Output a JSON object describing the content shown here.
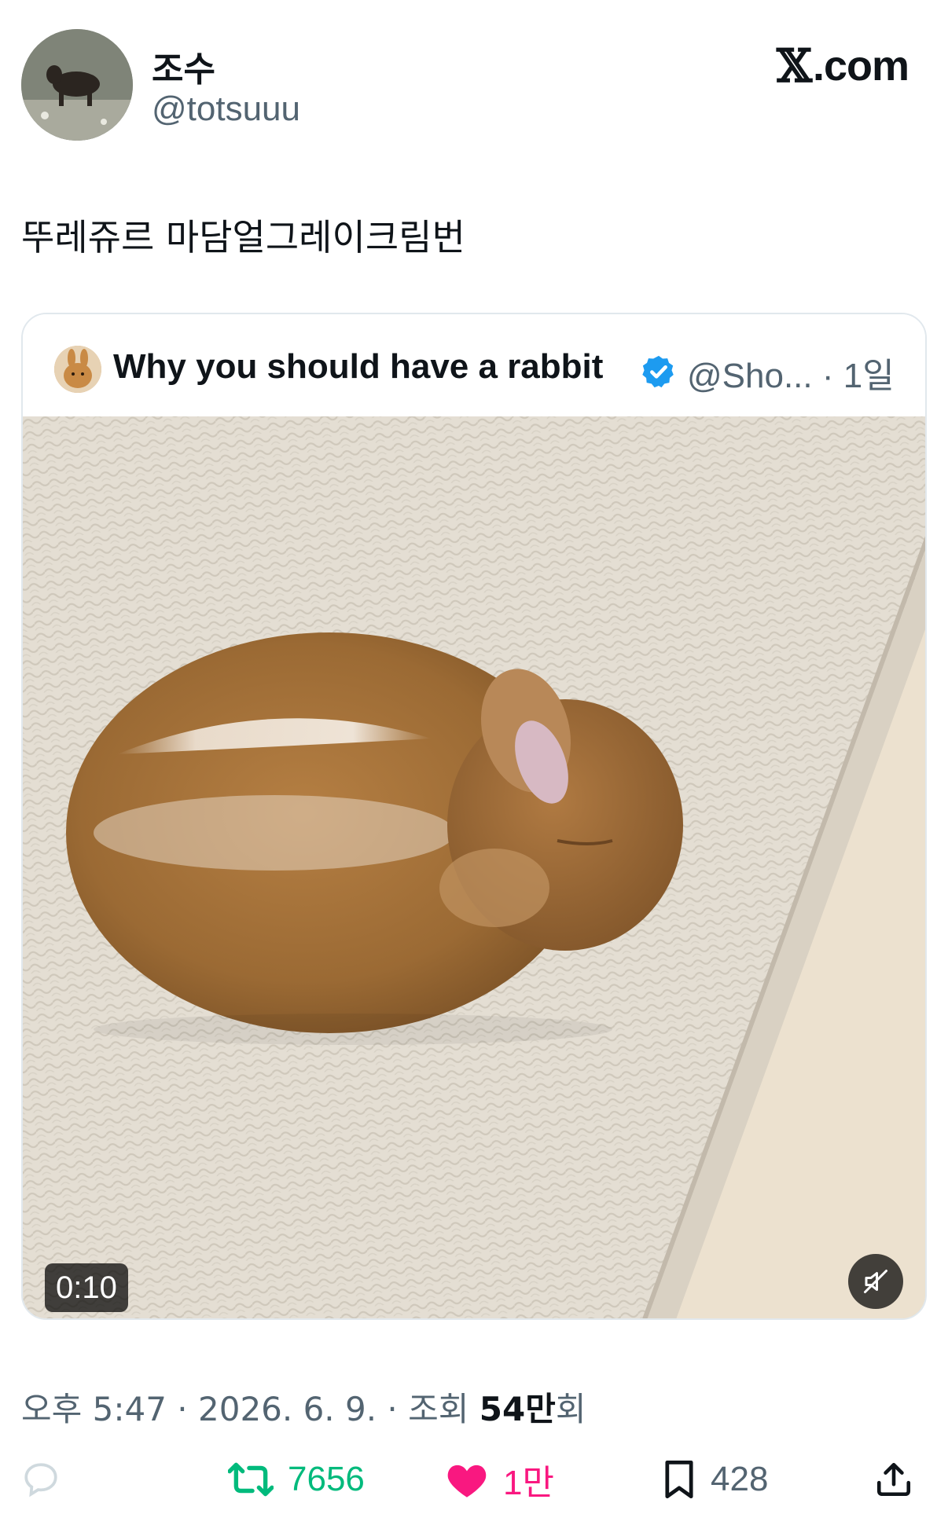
{
  "author": {
    "display_name": "조수",
    "handle": "@totsuuu"
  },
  "brand": {
    "x_glyph": "𝕏",
    "text": ".com"
  },
  "tweet": {
    "text": "뚜레쥬르 마담얼그레이크림번"
  },
  "quote": {
    "display_name": "Why you should have a rabbit",
    "handle_time": "@Sho... · 1일",
    "verified_color": "#1d9bf0",
    "media": {
      "duration": "0:10",
      "muted": true
    }
  },
  "meta": {
    "time_date": "오후 5:47 · 2026. 6. 9. · 조회 ",
    "views_number": "54만",
    "views_suffix": "회"
  },
  "actions": {
    "reply_icon": "reply-icon",
    "retweet_count": "7656",
    "retweet_color": "#00ba7c",
    "like_count": "1만",
    "like_color": "#f91880",
    "liked": true,
    "bookmark_count": "428",
    "share_icon": "share-icon"
  }
}
